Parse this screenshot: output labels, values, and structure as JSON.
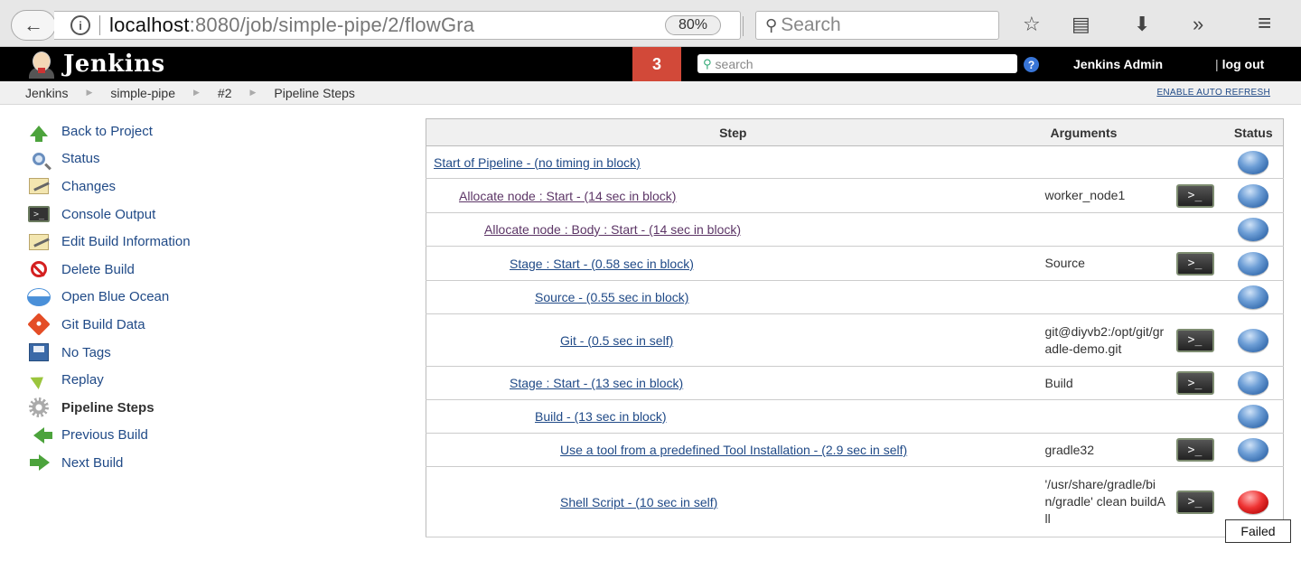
{
  "browser": {
    "url_host": "localhost",
    "url_rest": ":8080/job/simple-pipe/2/flowGra",
    "zoom": "80%",
    "search_placeholder": "Search",
    "back_icon": "back-arrow-icon",
    "reload_icon": "reload-icon",
    "overflow_icon": "»",
    "menu_icon": "≡"
  },
  "header": {
    "app_name": "Jenkins",
    "badge_count": "3",
    "search_placeholder": "search",
    "help_icon": "?",
    "user": "Jenkins Admin",
    "logout": "log out",
    "logout_sep": "|"
  },
  "breadcrumbs": [
    "Jenkins",
    "simple-pipe",
    "#2",
    "Pipeline Steps"
  ],
  "auto_refresh": "ENABLE AUTO REFRESH",
  "sidebar": {
    "items": [
      {
        "label": "Back to Project",
        "icon": "arrow-up-icon"
      },
      {
        "label": "Status",
        "icon": "magnifier-icon"
      },
      {
        "label": "Changes",
        "icon": "notepad-icon"
      },
      {
        "label": "Console Output",
        "icon": "console-icon"
      },
      {
        "label": "Edit Build Information",
        "icon": "notepad-icon"
      },
      {
        "label": "Delete Build",
        "icon": "delete-icon"
      },
      {
        "label": "Open Blue Ocean",
        "icon": "blue-ocean-icon"
      },
      {
        "label": "Git Build Data",
        "icon": "git-icon"
      },
      {
        "label": "No Tags",
        "icon": "save-icon"
      },
      {
        "label": "Replay",
        "icon": "replay-icon"
      },
      {
        "label": "Pipeline Steps",
        "icon": "gear-icon"
      },
      {
        "label": "Previous Build",
        "icon": "arrow-left-icon"
      },
      {
        "label": "Next Build",
        "icon": "arrow-right-icon"
      }
    ]
  },
  "table": {
    "headers": {
      "step": "Step",
      "arguments": "Arguments",
      "status": "Status"
    },
    "console_glyph": ">_",
    "rows": [
      {
        "step": "Start of Pipeline - (no timing in block)",
        "indent": 0,
        "args": "",
        "console": false,
        "status": "success",
        "visited": false
      },
      {
        "step": "Allocate node : Start - (14 sec in block)",
        "indent": 1,
        "args": "worker_node1",
        "console": true,
        "status": "success",
        "visited": true
      },
      {
        "step": "Allocate node : Body : Start - (14 sec in block)",
        "indent": 2,
        "args": "",
        "console": false,
        "status": "success",
        "visited": true
      },
      {
        "step": "Stage : Start - (0.58 sec in block)",
        "indent": 3,
        "args": "Source",
        "console": true,
        "status": "success",
        "visited": false
      },
      {
        "step": "Source - (0.55 sec in block)",
        "indent": 4,
        "args": "",
        "console": false,
        "status": "success",
        "visited": false
      },
      {
        "step": "Git - (0.5 sec in self)",
        "indent": 5,
        "args": "git@diyvb2:/opt/git/gradle-demo.git",
        "console": true,
        "status": "success",
        "visited": false
      },
      {
        "step": "Stage : Start - (13 sec in block)",
        "indent": 3,
        "args": "Build",
        "console": true,
        "status": "success",
        "visited": false
      },
      {
        "step": "Build - (13 sec in block)",
        "indent": 4,
        "args": "",
        "console": false,
        "status": "success",
        "visited": false
      },
      {
        "step": "Use a tool from a predefined Tool Installation - (2.9 sec in self)",
        "indent": 5,
        "args": "gradle32",
        "console": true,
        "status": "success",
        "visited": false
      },
      {
        "step": "Shell Script - (10 sec in self)",
        "indent": 5,
        "args": "'/usr/share/gradle/bin/gradle' clean buildAll",
        "console": true,
        "status": "failed",
        "visited": false
      }
    ]
  },
  "tooltip": "Failed",
  "colors": {
    "link": "#204a87",
    "visited": "#5c3566",
    "badge": "#d24939",
    "success": "#3a74c1",
    "failed": "#e33333"
  }
}
